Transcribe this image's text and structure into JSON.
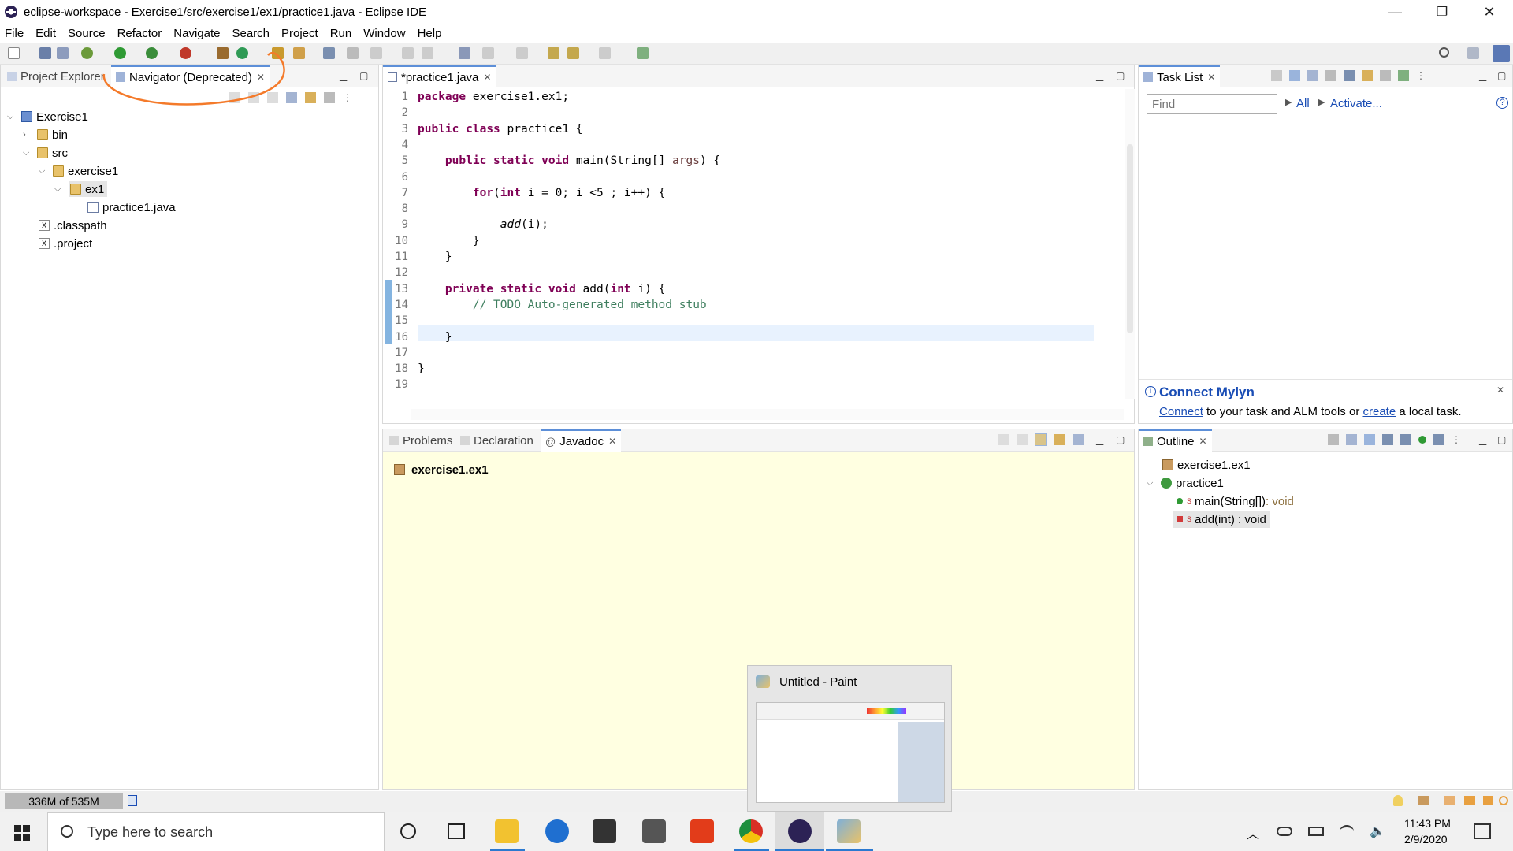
{
  "window": {
    "title": "eclipse-workspace - Exercise1/src/exercise1/ex1/practice1.java - Eclipse IDE",
    "minimize": "—",
    "restore": "❐",
    "close": "✕"
  },
  "menu": [
    "File",
    "Edit",
    "Source",
    "Refactor",
    "Navigate",
    "Search",
    "Project",
    "Run",
    "Window",
    "Help"
  ],
  "left_panel": {
    "tabs": [
      "Project Explorer",
      "Navigator (Deprecated)"
    ],
    "tree": [
      {
        "label": "Exercise1",
        "depth": 0,
        "icon": "project-icon",
        "expanded": true
      },
      {
        "label": "bin",
        "depth": 1,
        "icon": "folder-icon",
        "expanded": false
      },
      {
        "label": "src",
        "depth": 1,
        "icon": "folder-icon",
        "expanded": true
      },
      {
        "label": "exercise1",
        "depth": 2,
        "icon": "folder-icon",
        "expanded": true
      },
      {
        "label": "ex1",
        "depth": 3,
        "icon": "folder-open-icon",
        "expanded": true,
        "selected": true
      },
      {
        "label": "practice1.java",
        "depth": 4,
        "icon": "java-file-icon"
      },
      {
        "label": ".classpath",
        "depth": 1,
        "icon": "xml-file-icon"
      },
      {
        "label": ".project",
        "depth": 1,
        "icon": "xml-file-icon"
      }
    ]
  },
  "editor": {
    "tab": "*practice1.java",
    "lines": [
      "package exercise1.ex1;",
      "",
      "public class practice1 {",
      "",
      "    public static void main(String[] args) {",
      "",
      "        for(int i = 0; i <5 ; i++) {",
      "",
      "            add(i);",
      "        }",
      "    }",
      "",
      "    private static void add(int i) {",
      "        // TODO Auto-generated method stub",
      "",
      "    }",
      "",
      "}",
      ""
    ]
  },
  "task_list": {
    "tab": "Task List",
    "find_placeholder": "Find",
    "all": "All",
    "activate": "Activate...",
    "mylyn_title": "Connect Mylyn",
    "mylyn_connect": "Connect",
    "mylyn_mid": " to your task and ALM tools or ",
    "mylyn_create": "create",
    "mylyn_end": " a local task."
  },
  "bottom_panel": {
    "tabs": [
      "Problems",
      "Declaration",
      "Javadoc"
    ],
    "package": "exercise1.ex1"
  },
  "outline": {
    "tab": "Outline",
    "package": "exercise1.ex1",
    "class": "practice1",
    "main": "main(String[])",
    "main_type": " : void",
    "add": "add(int) : void"
  },
  "status": {
    "heap": "336M of 535M"
  },
  "paint_preview": {
    "title": "Untitled - Paint"
  },
  "taskbar": {
    "search_placeholder": "Type here to search",
    "time": "11:43 PM",
    "date": "2/9/2020"
  },
  "colors": {
    "keyword": "#7f0055",
    "comment": "#3f7f5f",
    "javadoc_bg": "#ffffe1",
    "annotation": "#f47a2a"
  }
}
